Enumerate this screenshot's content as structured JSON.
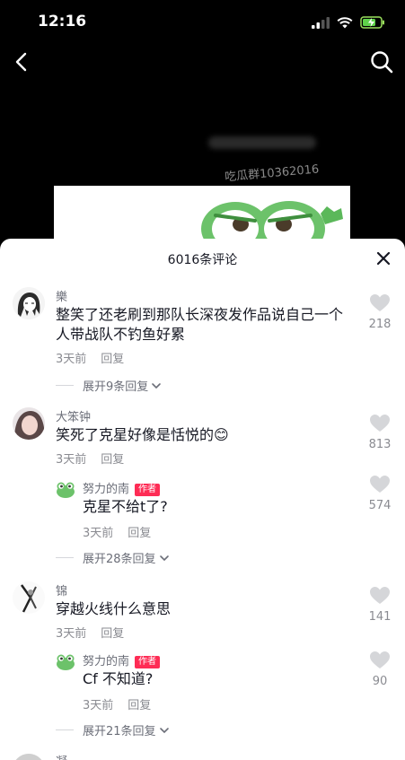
{
  "status": {
    "time": "12:16"
  },
  "video": {
    "watermark": "吃瓜群10362016"
  },
  "sheet": {
    "title": "6016条评论"
  },
  "comments": [
    {
      "name": "樂",
      "text": "整笑了还老刷到那队长深夜发作品说自己一个人带战队不钓鱼好累",
      "time": "3天前",
      "reply": "回复",
      "likes": "218",
      "expand": "展开9条回复"
    },
    {
      "name": "大笨钟",
      "text": "笑死了克星好像是恬悦的",
      "emoji": "😊",
      "time": "3天前",
      "reply": "回复",
      "likes": "813"
    },
    {
      "name": "努力的南",
      "author_tag": "作者",
      "text": "克星不给t了?",
      "time": "3天前",
      "reply": "回复",
      "likes": "574",
      "expand": "展开28条回复"
    },
    {
      "name": "锦",
      "text": "穿越火线什么意思",
      "time": "3天前",
      "reply": "回复",
      "likes": "141"
    },
    {
      "name": "努力的南",
      "author_tag": "作者",
      "text": "Cf 不知道?",
      "time": "3天前",
      "reply": "回复",
      "likes": "90",
      "expand": "展开21条回复"
    },
    {
      "name": "凝"
    }
  ]
}
